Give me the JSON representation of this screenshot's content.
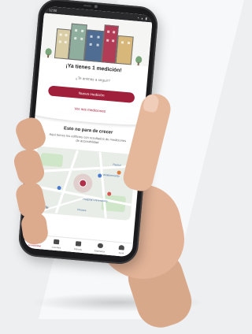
{
  "status_bar": {
    "time": "12:00",
    "icons": "▪ ▴ ▮"
  },
  "content": {
    "headline": "¡Ya tienes 1 medición!",
    "subline": "¿Te animas a seguir?",
    "primary_button": "Nueva medición",
    "link": "Ver mis mediciones",
    "section_title": "Esto no para de crecer",
    "section_description": "Aquí tienes los edificios con resultados de mediciones de accesibilidad"
  },
  "map": {
    "labels": [
      "Valdebernardo",
      "Repsol",
      "Pinares",
      "Hospital Universitario"
    ],
    "attribution": "Google"
  },
  "bottom_nav": {
    "items": [
      {
        "label": "Accesibilidad",
        "icon": "home-icon",
        "active": true
      },
      {
        "label": "Lucentes",
        "icon": "calendar-icon",
        "active": false
      },
      {
        "label": "Noticias",
        "icon": "news-icon",
        "active": false
      },
      {
        "label": "Esperanza",
        "icon": "chat-icon",
        "active": false
      },
      {
        "label": "Perfil",
        "icon": "person-icon",
        "active": false
      }
    ]
  },
  "colors": {
    "brand": "#a01f3a",
    "background": "#eeeff1",
    "skin": "#e2b397",
    "phone_body": "#1b1b1d"
  }
}
